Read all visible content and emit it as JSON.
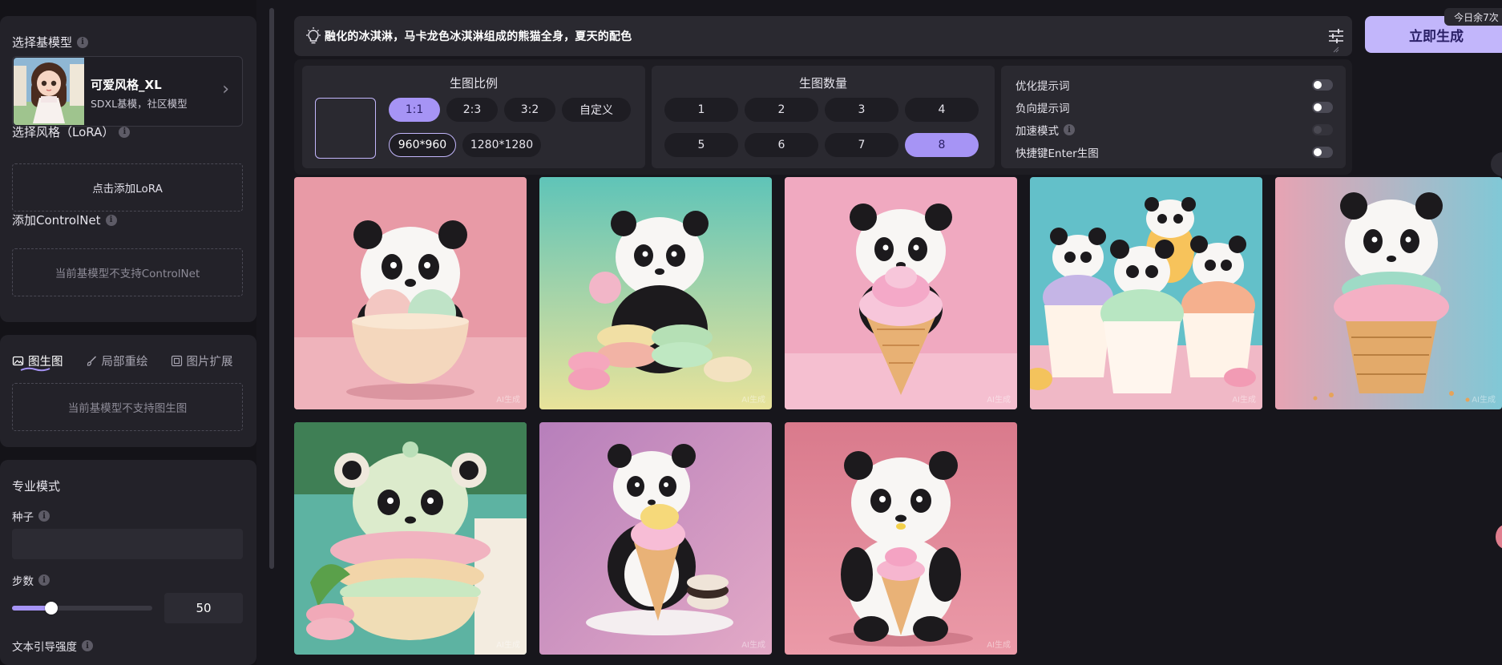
{
  "sidebar": {
    "base_model": {
      "label": "选择基模型",
      "name": "可爱风格_XL",
      "subtitle": "SDXL基模，社区模型"
    },
    "lora": {
      "label": "选择风格（LoRA）",
      "add_text": "点击添加LoRA"
    },
    "controlnet": {
      "label": "添加ControlNet",
      "unsupported_text": "当前基模型不支持ControlNet"
    },
    "mode_tabs": [
      {
        "label": "图生图",
        "icon": "image-icon",
        "active": true
      },
      {
        "label": "局部重绘",
        "icon": "brush-icon",
        "active": false
      },
      {
        "label": "图片扩展",
        "icon": "expand-icon",
        "active": false
      }
    ],
    "img2img_unsupported_text": "当前基模型不支持图生图",
    "pro_mode": {
      "title": "专业模式",
      "seed_label": "种子",
      "seed_value": "",
      "steps_label": "步数",
      "steps_value": "50",
      "steps_fraction": 0.28,
      "cfg_label": "文本引导强度"
    }
  },
  "prompt": {
    "text": "融化的冰淇淋，马卡龙色冰淇淋组成的熊猫全身，夏天的配色"
  },
  "generate_button": "立即生成",
  "quota_badge": "今日余7次",
  "ratio": {
    "title": "生图比例",
    "options": [
      "1:1",
      "2:3",
      "3:2",
      "自定义"
    ],
    "selected": "1:1",
    "sizes": [
      "960*960",
      "1280*1280"
    ],
    "selected_size": "960*960"
  },
  "count": {
    "title": "生图数量",
    "options": [
      "1",
      "2",
      "3",
      "4",
      "5",
      "6",
      "7",
      "8"
    ],
    "selected": "8"
  },
  "options": [
    {
      "label": "优化提示词",
      "on": false,
      "disabled": false,
      "info": false
    },
    {
      "label": "负向提示词",
      "on": false,
      "disabled": false,
      "info": false
    },
    {
      "label": "加速模式",
      "on": false,
      "disabled": true,
      "info": true
    },
    {
      "label": "快捷键Enter生图",
      "on": false,
      "disabled": false,
      "info": false
    }
  ],
  "gallery": {
    "watermark": "AI生成",
    "images": [
      {
        "scene": "panda-bowl-macaron-scoops",
        "bg": "#e89aa6"
      },
      {
        "scene": "panda-stacked-macarons",
        "bg": "#5fc4b8"
      },
      {
        "scene": "panda-cone-pink-swirl",
        "bg": "#f0a9c0"
      },
      {
        "scene": "four-pandas-ice-cream-cups",
        "bg": "#63c0c9"
      },
      {
        "scene": "panda-waffle-cone-macaron",
        "bg": "#e7a3b3"
      },
      {
        "scene": "panda-layered-cake",
        "bg": "#5db3a2"
      },
      {
        "scene": "panda-holding-cone-plate",
        "bg": "#c98fc0"
      },
      {
        "scene": "panda-small-cone",
        "bg": "#e08797"
      }
    ]
  },
  "colors": {
    "accent": "#a694f5",
    "accent_light": "#c2b6fb",
    "panel": "#232229",
    "background": "#17161c"
  }
}
